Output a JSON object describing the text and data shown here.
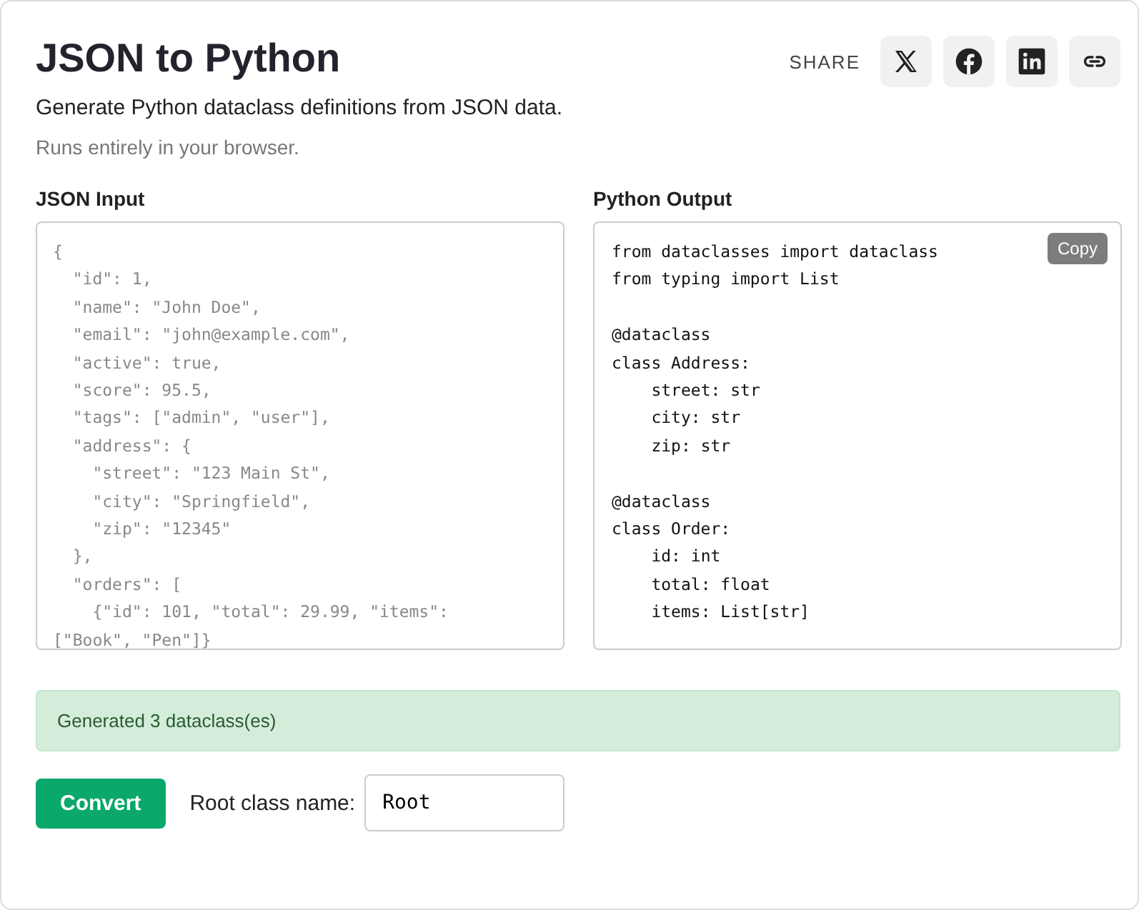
{
  "header": {
    "title": "JSON to Python",
    "subtitle": "Generate Python dataclass definitions from JSON data.",
    "note": "Runs entirely in your browser.",
    "share_label": "SHARE",
    "share_buttons": [
      {
        "kind": "x"
      },
      {
        "kind": "facebook"
      },
      {
        "kind": "linkedin"
      },
      {
        "kind": "link"
      }
    ]
  },
  "input": {
    "label": "JSON Input",
    "placeholder": "{\n  \"id\": 1,\n  \"name\": \"John Doe\",\n  \"email\": \"john@example.com\",\n  \"active\": true,\n  \"score\": 95.5,\n  \"tags\": [\"admin\", \"user\"],\n  \"address\": {\n    \"street\": \"123 Main St\",\n    \"city\": \"Springfield\",\n    \"zip\": \"12345\"\n  },\n  \"orders\": [\n    {\"id\": 101, \"total\": 29.99, \"items\":\n[\"Book\", \"Pen\"]}"
  },
  "output": {
    "label": "Python Output",
    "copy_button": "Copy",
    "value": "from dataclasses import dataclass\nfrom typing import List\n\n@dataclass\nclass Address:\n    street: str\n    city: str\n    zip: str\n\n@dataclass\nclass Order:\n    id: int\n    total: float\n    items: List[str]"
  },
  "status": "Generated 3 dataclass(es)",
  "convert_button": "Convert",
  "root_class": {
    "label": "Root class name:",
    "value": "Root"
  }
}
